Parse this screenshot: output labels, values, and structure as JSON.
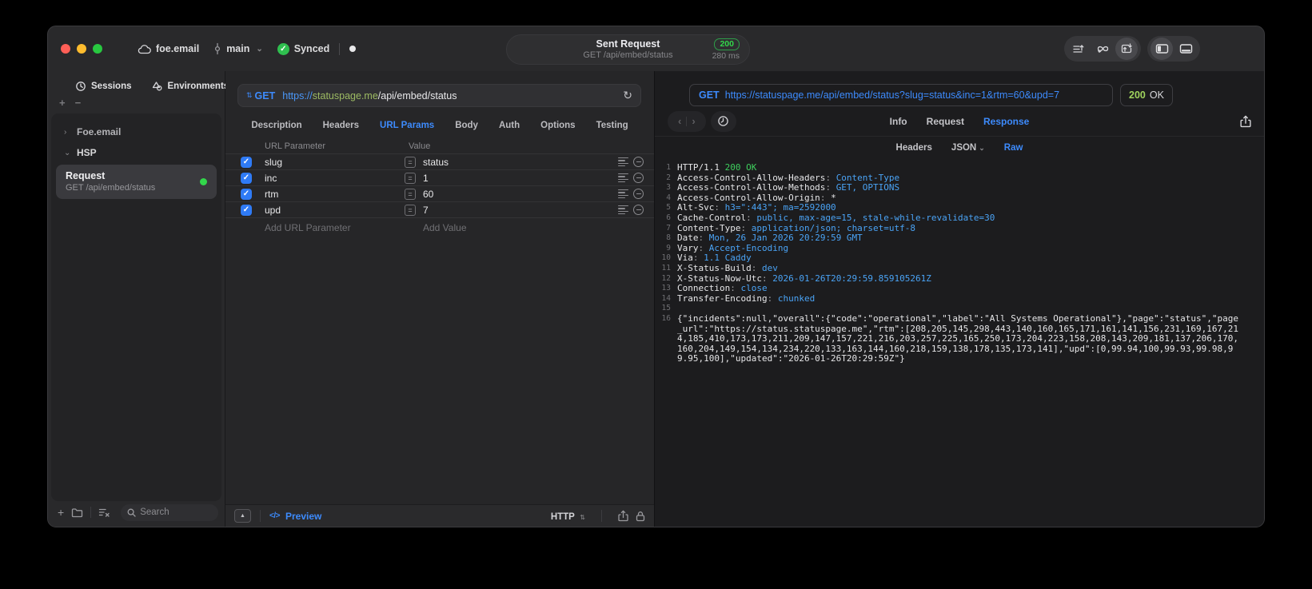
{
  "icons": {
    "check": "✓",
    "equals": "=",
    "chevron_down": "⌄",
    "chevron_right": "›",
    "chevron_left": "‹",
    "sort_updown": "⇅",
    "refresh": "↻",
    "expand_up": "▲",
    "plus": "+",
    "minus": "−"
  },
  "titlebar": {
    "workspace": "foe.email",
    "branch": "main",
    "sync_label": "Synced",
    "request_pill": {
      "title": "Sent Request",
      "subtitle": "GET /api/embed/status",
      "status_code": "200",
      "duration": "280 ms"
    }
  },
  "sidebar": {
    "tabs": [
      {
        "label": "Sessions",
        "icon": "history-icon"
      },
      {
        "label": "Environments",
        "icon": "shapes-icon"
      }
    ],
    "tree": {
      "groups": [
        {
          "label": "Foe.email",
          "collapsed": true
        },
        {
          "label": "HSP",
          "collapsed": false
        }
      ],
      "selected_request": {
        "title": "Request",
        "subtitle": "GET /api/embed/status",
        "status_dot_color": "#32d74b"
      }
    },
    "search_placeholder": "Search"
  },
  "request_panel": {
    "method": "GET",
    "url": {
      "scheme": "https://",
      "host": "statuspage.me",
      "path": "/api/embed/status"
    },
    "tabs": [
      "Description",
      "Headers",
      "URL Params",
      "Body",
      "Auth",
      "Options",
      "Testing"
    ],
    "active_tab": "URL Params",
    "param_table": {
      "columns": [
        "URL Parameter",
        "Value"
      ],
      "rows": [
        {
          "name": "slug",
          "value": "status",
          "enabled": true
        },
        {
          "name": "inc",
          "value": "1",
          "enabled": true
        },
        {
          "name": "rtm",
          "value": "60",
          "enabled": true
        },
        {
          "name": "upd",
          "value": "7",
          "enabled": true
        }
      ],
      "add_param_label": "Add URL Parameter",
      "add_value_label": "Add Value"
    },
    "footer": {
      "code_glyph": "</>",
      "preview_label": "Preview",
      "http_label": "HTTP"
    }
  },
  "response_panel": {
    "method": "GET",
    "url": "https://statuspage.me/api/embed/status?slug=status&inc=1&rtm=60&upd=7",
    "status_code": "200",
    "status_text": "OK",
    "tabs": [
      "Info",
      "Request",
      "Response"
    ],
    "active_tab": "Response",
    "subtabs": [
      "Headers",
      "JSON",
      "Raw"
    ],
    "active_subtab": "Raw",
    "colors": {
      "accent_blue": "#3d8bfd",
      "value_blue": "#4aa3f5",
      "status_green": "#3ecf5e"
    },
    "raw_lines": [
      {
        "n": "1",
        "seg": [
          [
            "HTTP/1.1 ",
            "w"
          ],
          [
            "200 OK",
            "g"
          ]
        ]
      },
      {
        "n": "2",
        "seg": [
          [
            "Access-Control-Allow-Headers",
            "w"
          ],
          [
            ": ",
            "d"
          ],
          [
            "Content-Type",
            "b"
          ]
        ]
      },
      {
        "n": "3",
        "seg": [
          [
            "Access-Control-Allow-Methods",
            "w"
          ],
          [
            ": ",
            "d"
          ],
          [
            "GET, OPTIONS",
            "b"
          ]
        ]
      },
      {
        "n": "4",
        "seg": [
          [
            "Access-Control-Allow-Origin",
            "w"
          ],
          [
            ": ",
            "d"
          ],
          [
            "*",
            "w"
          ]
        ]
      },
      {
        "n": "5",
        "seg": [
          [
            "Alt-Svc",
            "w"
          ],
          [
            ": ",
            "d"
          ],
          [
            "h3=\":443\"; ma=2592000",
            "b"
          ]
        ]
      },
      {
        "n": "6",
        "seg": [
          [
            "Cache-Control",
            "w"
          ],
          [
            ": ",
            "d"
          ],
          [
            "public, max-age=15, stale-while-revalidate=30",
            "b"
          ]
        ]
      },
      {
        "n": "7",
        "seg": [
          [
            "Content-Type",
            "w"
          ],
          [
            ": ",
            "d"
          ],
          [
            "application/json; charset=utf-8",
            "b"
          ]
        ]
      },
      {
        "n": "8",
        "seg": [
          [
            "Date",
            "w"
          ],
          [
            ": ",
            "d"
          ],
          [
            "Mon, 26 Jan 2026 20:29:59 GMT",
            "b"
          ]
        ]
      },
      {
        "n": "9",
        "seg": [
          [
            "Vary",
            "w"
          ],
          [
            ": ",
            "d"
          ],
          [
            "Accept-Encoding",
            "b"
          ]
        ]
      },
      {
        "n": "10",
        "seg": [
          [
            "Via",
            "w"
          ],
          [
            ": ",
            "d"
          ],
          [
            "1.1 Caddy",
            "b"
          ]
        ]
      },
      {
        "n": "11",
        "seg": [
          [
            "X-Status-Build",
            "w"
          ],
          [
            ": ",
            "d"
          ],
          [
            "dev",
            "b"
          ]
        ]
      },
      {
        "n": "12",
        "seg": [
          [
            "X-Status-Now-Utc",
            "w"
          ],
          [
            ": ",
            "d"
          ],
          [
            "2026-01-26T20:29:59.859105261Z",
            "b"
          ]
        ]
      },
      {
        "n": "13",
        "seg": [
          [
            "Connection",
            "w"
          ],
          [
            ": ",
            "d"
          ],
          [
            "close",
            "b"
          ]
        ]
      },
      {
        "n": "14",
        "seg": [
          [
            "Transfer-Encoding",
            "w"
          ],
          [
            ": ",
            "d"
          ],
          [
            "chunked",
            "b"
          ]
        ]
      },
      {
        "n": "15",
        "seg": []
      },
      {
        "n": "16",
        "seg": [
          [
            "{\"incidents\":null,\"overall\":{\"code\":\"operational\",\"label\":\"All Systems Operational\"},\"page\":\"status\",\"page_url\":\"https://status.statuspage.me\",\"rtm\":[208,205,145,298,443,140,160,165,171,161,141,156,231,169,167,214,185,410,173,173,211,209,147,157,221,216,203,257,225,165,250,173,204,223,158,208,143,209,181,137,206,170,160,204,149,154,134,234,220,133,163,144,160,218,159,138,178,135,173,141],\"upd\":[0,99.94,100,99.93,99.98,99.95,100],\"updated\":\"2026-01-26T20:29:59Z\"}",
            "w"
          ]
        ]
      }
    ]
  }
}
